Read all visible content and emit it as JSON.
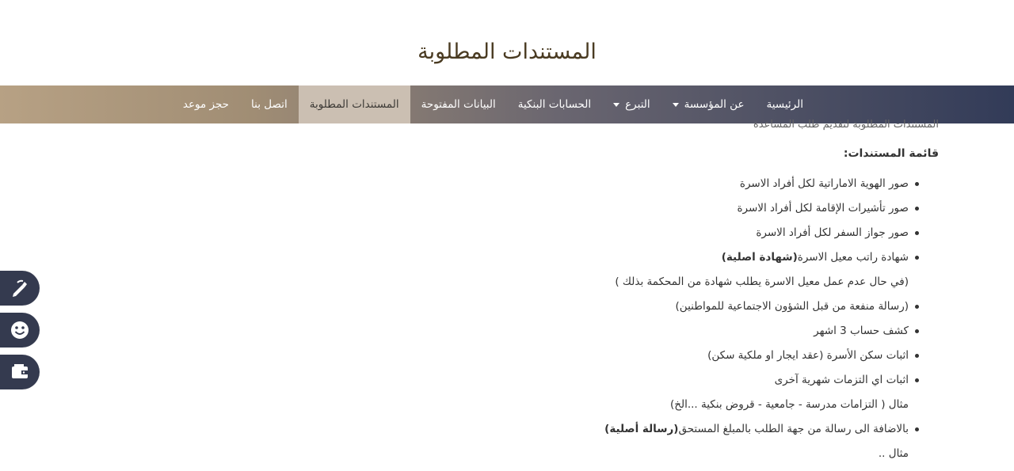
{
  "header": {
    "title": "المستندات المطلوبة"
  },
  "nav": {
    "items": [
      {
        "label": "الرئيسية"
      },
      {
        "label": "عن المؤسسة"
      },
      {
        "label": "التبرع"
      },
      {
        "label": "الحسابات البنكية"
      },
      {
        "label": "البيانات المفتوحة"
      },
      {
        "label": "المستندات المطلوبة"
      },
      {
        "label": "اتصل بنا"
      },
      {
        "label": "حجز موعد"
      }
    ]
  },
  "content": {
    "intro_cut": "المستندات المطلوبة لتقديم طلب المساعدة",
    "heading": "قائمة المستندات:",
    "items": [
      "صور الهوية الاماراتية لكل أفراد الاسرة",
      "صور تأشيرات الإقامة لكل أفراد الاسرة",
      "صور جواز السفر لكل أفراد الاسرة",
      "شهادة راتب معيل الاسرة",
      "(شهادة اصلية)",
      "(في حال عدم عمل معيل الاسرة يطلب شهادة من المحكمة بذلك )",
      "(رسالة منفعة من قبل الشؤون الاجتماعية للمواطنين)",
      "كشف حساب 3 اشهر",
      "اثبات سكن الأسرة (عقد ايجار او ملكية سكن)",
      "اثبات اي التزمات شهرية آخرى",
      "مثال ( التزامات مدرسة - جامعية - قروض بنكية ...الخ)",
      "بالاضافة الى رسالة من جهة الطلب بالمبلغ المستحق",
      "(رسالة أصلية)",
      "مثال .."
    ]
  },
  "side_tabs": {
    "icons": [
      "pen-icon",
      "smiley-icon",
      "wallet-icon"
    ]
  },
  "colors": {
    "nav_start": "#323b58",
    "nav_end": "#b7a184",
    "nav_active": "#cbbfb2",
    "title": "#4a3b22",
    "side_tab": "#343a4f"
  }
}
